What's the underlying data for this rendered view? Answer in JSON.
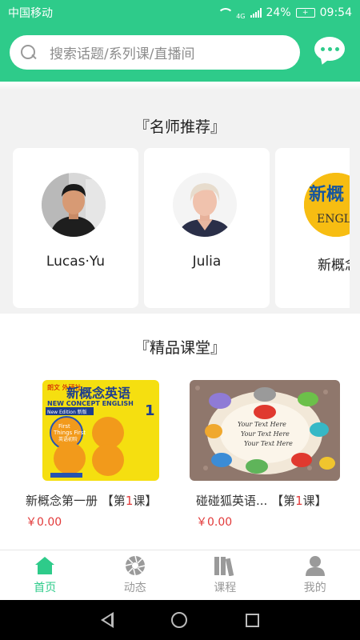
{
  "status": {
    "carrier": "中国移动",
    "network": "4G",
    "battery": "24%",
    "time": "09:54"
  },
  "search": {
    "placeholder": "搜索话题/系列课/直播间"
  },
  "teachers": {
    "title": "『名师推荐』",
    "items": [
      {
        "name": "Lucas·Yu"
      },
      {
        "name": "Julia"
      },
      {
        "name": "新概念",
        "avatar_text": "新概",
        "avatar_sub": "ENGL"
      }
    ]
  },
  "courses": {
    "title": "『精品课堂』",
    "items": [
      {
        "title": "新概念第一册",
        "lesson_prefix": "【第",
        "lesson_num": "1",
        "lesson_suffix": "课】",
        "price": "￥0.00",
        "cover": {
          "badge": "朗文 外研社",
          "title": "新概念英语",
          "subtitle": "NEW CONCEPT ENGLISH",
          "volume": "1",
          "edition": "New Edition 新版",
          "tag1": "First",
          "tag2": "Things First",
          "tag3": "英语初阶"
        }
      },
      {
        "title": "碰碰狐英语...",
        "lesson_prefix": "【第",
        "lesson_num": "1",
        "lesson_suffix": "课】",
        "price": "￥0.00",
        "cover": {
          "line1": "Your Text Here",
          "line2": "Your Text Here",
          "line3": "Your Text Here"
        }
      }
    ]
  },
  "tabs": [
    {
      "label": "首页",
      "icon": "home-icon",
      "active": true
    },
    {
      "label": "动态",
      "icon": "aperture-icon",
      "active": false
    },
    {
      "label": "课程",
      "icon": "books-icon",
      "active": false
    },
    {
      "label": "我的",
      "icon": "person-icon",
      "active": false
    }
  ],
  "colors": {
    "primary": "#2ecb8a",
    "price": "#e23a3a",
    "inactive": "#999999"
  }
}
